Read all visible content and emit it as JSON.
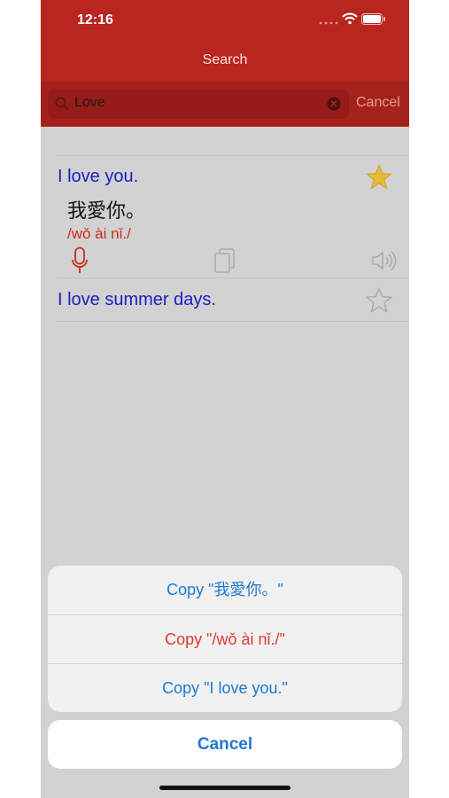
{
  "status": {
    "time": "12:16"
  },
  "nav": {
    "title": "Search"
  },
  "search": {
    "value": "Love",
    "cancel_label": "Cancel"
  },
  "results": [
    {
      "english": "I love you.",
      "chinese": "我愛你。",
      "pinyin": "/wǒ ài nǐ./",
      "favorite": true
    },
    {
      "english": "I love summer days.",
      "favorite": false
    }
  ],
  "action_sheet": {
    "options": [
      {
        "label": "Copy \"我愛你。\"",
        "color": "#1f78d1"
      },
      {
        "label": "Copy \"/wǒ ài nǐ./\"",
        "color": "#e03a2f"
      },
      {
        "label": "Copy \"I love you.\"",
        "color": "#1f78d1"
      }
    ],
    "cancel_label": "Cancel"
  },
  "colors": {
    "header": "#b8261f",
    "favorite_star": "#e6bb3a",
    "english_text": "#1c1cbf",
    "pinyin_text": "#cc2a20"
  }
}
